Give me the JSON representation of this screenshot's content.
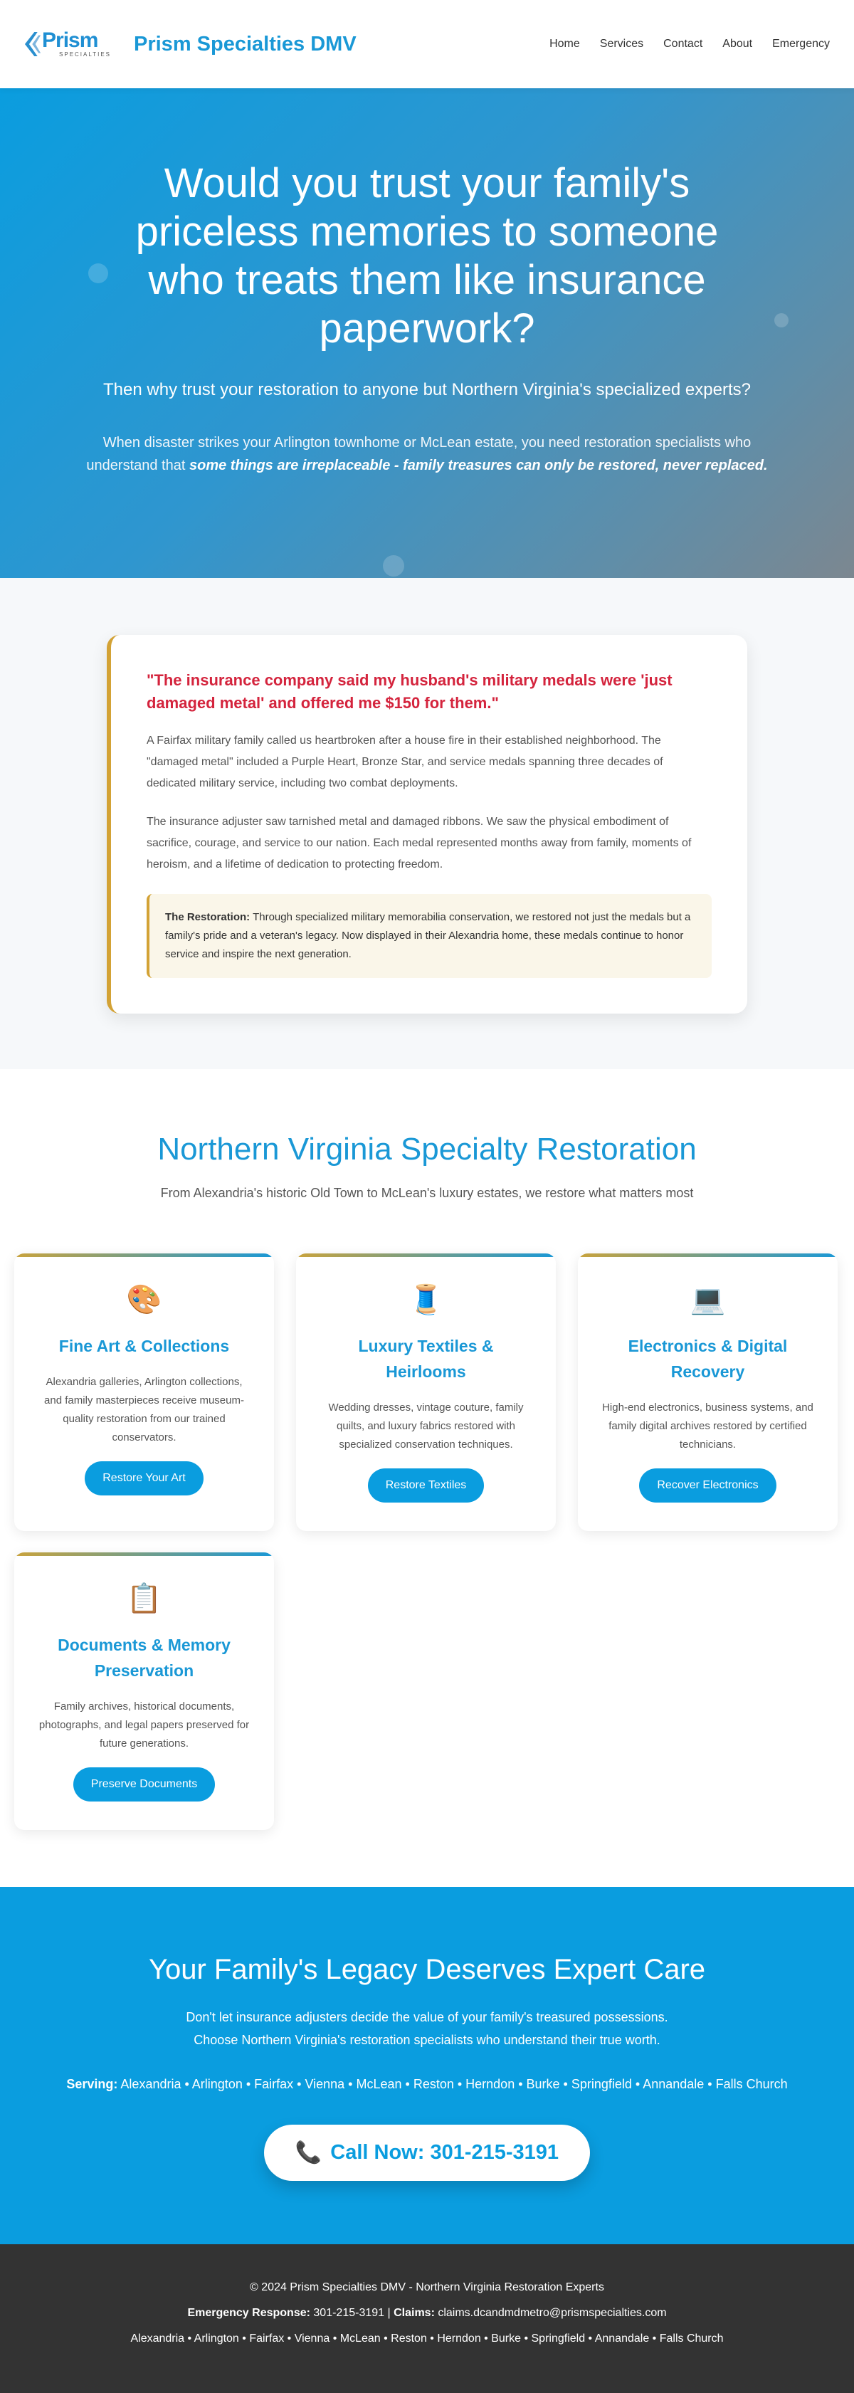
{
  "header": {
    "logo_word": "Prism",
    "logo_sub": "SPECIALTIES",
    "brand": "Prism Specialties DMV",
    "nav": [
      "Home",
      "Services",
      "Contact",
      "About",
      "Emergency"
    ]
  },
  "hero": {
    "title": "Would you trust your family's priceless memories to someone who treats them like insurance paperwork?",
    "subtitle": "Then why trust your restoration to anyone but Northern Virginia's specialized experts?",
    "body_start": "When disaster strikes your Arlington townhome or McLean estate, you need restoration specialists who understand that ",
    "body_emphasis": "some things are irreplaceable - family treasures can only be restored, never replaced."
  },
  "testimonial": {
    "quote": "\"The insurance company said my husband's military medals were 'just damaged metal' and offered me $150 for them.\"",
    "para1": "A Fairfax military family called us heartbroken after a house fire in their established neighborhood. The \"damaged metal\" included a Purple Heart, Bronze Star, and service medals spanning three decades of dedicated military service, including two combat deployments.",
    "para2": "The insurance adjuster saw tarnished metal and damaged ribbons. We saw the physical embodiment of sacrifice, courage, and service to our nation. Each medal represented months away from family, moments of heroism, and a lifetime of dedication to protecting freedom.",
    "restoration_label": "The Restoration:",
    "restoration_text": " Through specialized military memorabilia conservation, we restored not just the medals but a family's pride and a veteran's legacy. Now displayed in their Alexandria home, these medals continue to honor service and inspire the next generation."
  },
  "services": {
    "title": "Northern Virginia Specialty Restoration",
    "subtitle": "From Alexandria's historic Old Town to McLean's luxury estates, we restore what matters most",
    "cards": [
      {
        "icon": "🎨",
        "title": "Fine Art & Collections",
        "desc": "Alexandria galleries, Arlington collections, and family masterpieces receive museum-quality restoration from our trained conservators.",
        "button": "Restore Your Art"
      },
      {
        "icon": "🧵",
        "title": "Luxury Textiles & Heirlooms",
        "desc": "Wedding dresses, vintage couture, family quilts, and luxury fabrics restored with specialized conservation techniques.",
        "button": "Restore Textiles"
      },
      {
        "icon": "💻",
        "title": "Electronics & Digital Recovery",
        "desc": "High-end electronics, business systems, and family digital archives restored by certified technicians.",
        "button": "Recover Electronics"
      },
      {
        "icon": "📋",
        "title": "Documents & Memory Preservation",
        "desc": "Family archives, historical documents, photographs, and legal papers preserved for future generations.",
        "button": "Preserve Documents"
      }
    ]
  },
  "cta": {
    "title": "Your Family's Legacy Deserves Expert Care",
    "line1": "Don't let insurance adjusters decide the value of your family's treasured possessions.",
    "line2": "Choose Northern Virginia's restoration specialists who understand their true worth.",
    "serving_label": "Serving:",
    "serving_list": " Alexandria • Arlington • Fairfax • Vienna • McLean • Reston • Herndon • Burke • Springfield • Annandale • Falls Church",
    "phone_icon": "📞",
    "button": "Call Now: 301-215-3191"
  },
  "footer": {
    "copyright": "© 2024 Prism Specialties DMV - Northern Virginia Restoration Experts",
    "emergency_label": "Emergency Response:",
    "emergency_phone": " 301-215-3191 | ",
    "claims_label": "Claims:",
    "claims_email": " claims.dcandmdmetro@prismspecialties.com",
    "areas": "Alexandria • Arlington • Fairfax • Vienna • McLean • Reston • Herndon • Burke • Springfield • Annandale • Falls Church"
  }
}
